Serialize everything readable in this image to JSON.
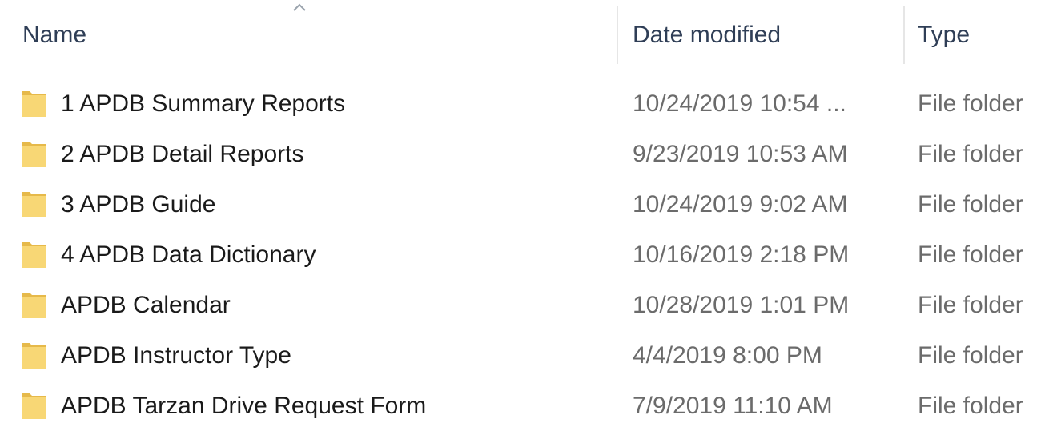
{
  "columns": {
    "name": "Name",
    "date_modified": "Date modified",
    "type": "Type"
  },
  "sort": {
    "column": "name",
    "icon": "chevron-up-icon"
  },
  "colors": {
    "folder": "#f8d775",
    "folder_dark": "#e6b94a",
    "header_text": "#2f3e56"
  },
  "rows": [
    {
      "name": "1 APDB Summary Reports",
      "date": "10/24/2019 10:54 ...",
      "type": "File folder",
      "icon": "folder-icon"
    },
    {
      "name": "2 APDB Detail Reports",
      "date": "9/23/2019 10:53 AM",
      "type": "File folder",
      "icon": "folder-icon"
    },
    {
      "name": "3 APDB Guide",
      "date": "10/24/2019 9:02 AM",
      "type": "File folder",
      "icon": "folder-icon"
    },
    {
      "name": "4 APDB Data Dictionary",
      "date": "10/16/2019 2:18 PM",
      "type": "File folder",
      "icon": "folder-icon"
    },
    {
      "name": "APDB Calendar",
      "date": "10/28/2019 1:01 PM",
      "type": "File folder",
      "icon": "folder-icon"
    },
    {
      "name": "APDB Instructor Type",
      "date": "4/4/2019 8:00 PM",
      "type": "File folder",
      "icon": "folder-icon"
    },
    {
      "name": "APDB Tarzan Drive Request Form",
      "date": "7/9/2019 11:10 AM",
      "type": "File folder",
      "icon": "folder-icon"
    }
  ]
}
